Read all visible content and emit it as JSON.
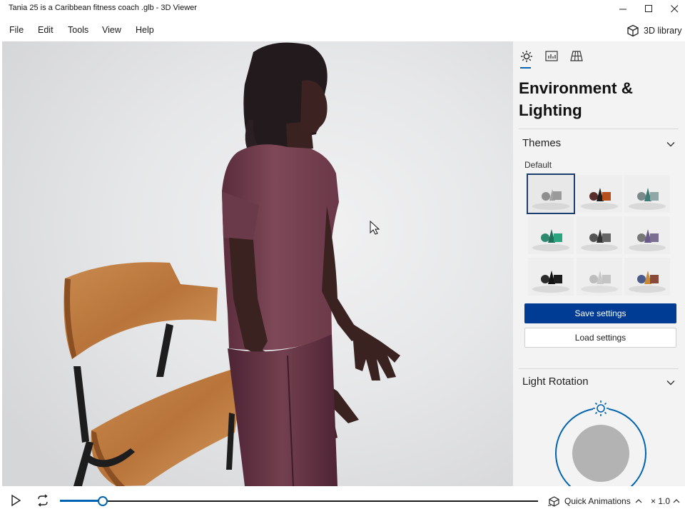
{
  "window": {
    "title": "Tania 25 is a Caribbean fitness coach .glb - 3D Viewer",
    "minimize_icon": "minimize-icon",
    "maximize_icon": "maximize-icon",
    "close_icon": "close-icon"
  },
  "menu": {
    "items": [
      {
        "label": "File"
      },
      {
        "label": "Edit"
      },
      {
        "label": "Tools"
      },
      {
        "label": "View"
      },
      {
        "label": "Help"
      }
    ],
    "library_label": "3D library",
    "library_icon": "cube-icon"
  },
  "panel": {
    "tabs": [
      {
        "icon": "sun-icon",
        "active": true
      },
      {
        "icon": "stats-icon",
        "active": false
      },
      {
        "icon": "grid-icon",
        "active": false
      }
    ],
    "title": "Environment & Lighting",
    "themes": {
      "header": "Themes",
      "caption": "Default",
      "selected_index": 0,
      "items": [
        {
          "scene": "default-gray"
        },
        {
          "scene": "dark-cone-orange"
        },
        {
          "scene": "teal-cone"
        },
        {
          "scene": "green-cube"
        },
        {
          "scene": "dark-gray"
        },
        {
          "scene": "purple-gray"
        },
        {
          "scene": "black-shapes"
        },
        {
          "scene": "light-gray"
        },
        {
          "scene": "blue-brown"
        }
      ]
    },
    "save_label": "Save settings",
    "load_label": "Load settings",
    "light_rotation": {
      "header": "Light Rotation",
      "icon": "light-source-icon"
    }
  },
  "playback": {
    "play_icon": "play-icon",
    "loop_icon": "loop-icon",
    "progress": 0.09,
    "quick_animations_label": "Quick Animations",
    "quick_animations_icon": "animation-icon",
    "speed_label": "× 1.0"
  },
  "colors": {
    "accent": "#0063b1",
    "primary_button": "#003b94",
    "panel_bg": "#f3f3f3"
  }
}
